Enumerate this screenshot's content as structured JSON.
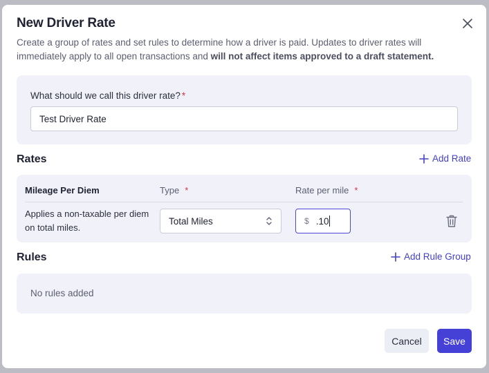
{
  "dialog": {
    "title": "New Driver Rate",
    "description_main": "Create a group of rates and set rules to determine how a driver is paid. Updates to driver rates will immediately apply to all open transactions and ",
    "description_bold": "will not affect items approved to a draft statement."
  },
  "name_field": {
    "label": "What should we call this driver rate?",
    "required_mark": "*",
    "value": "Test Driver Rate"
  },
  "rates": {
    "title": "Rates",
    "add_label": "Add Rate",
    "headers": {
      "name": "Mileage Per Diem",
      "type": "Type",
      "rate": "Rate per mile",
      "required_mark": "*"
    },
    "row": {
      "description": "Applies a non-taxable per diem on total miles.",
      "type_value": "Total Miles",
      "currency_prefix": "$",
      "rate_value": ".10"
    }
  },
  "rules": {
    "title": "Rules",
    "add_label": "Add Rule Group",
    "empty_text": "No rules added"
  },
  "footer": {
    "cancel_label": "Cancel",
    "save_label": "Save"
  },
  "colors": {
    "accent": "#4540d6",
    "panel_bg": "#f1f2f9",
    "required": "#d03545"
  }
}
